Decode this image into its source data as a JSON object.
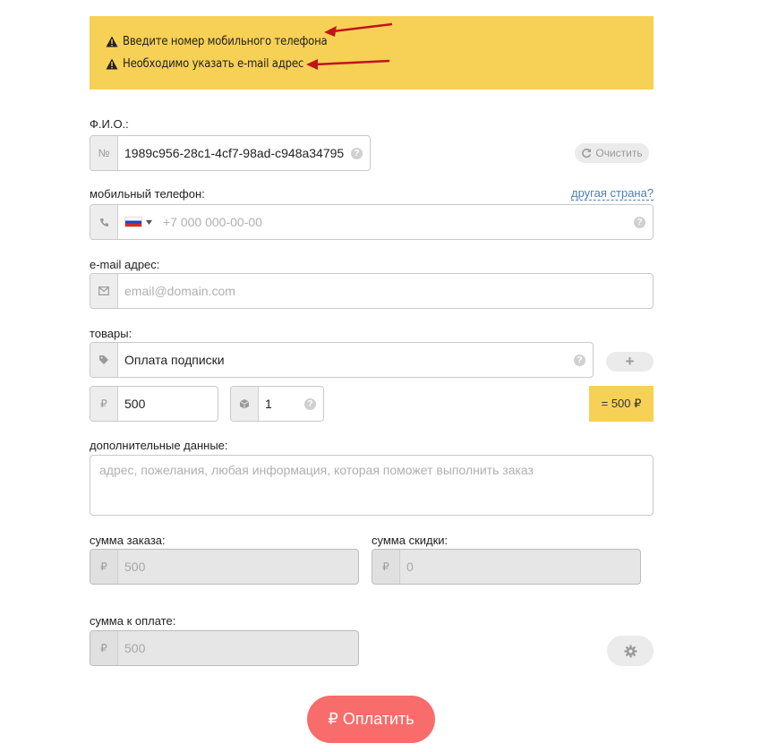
{
  "alert": {
    "messages": [
      "Введите номер мобильного телефона",
      "Необходимо указать e-mail адрес"
    ]
  },
  "name_field": {
    "label": "Ф.И.О.:",
    "addon_icon": "№",
    "value": "1989c956-28c1-4cf7-98ad-c948a34795",
    "help": "?"
  },
  "clear_button": {
    "label": "Очистить",
    "icon": "refresh-icon"
  },
  "phone_field": {
    "label": "мобильный телефон:",
    "other_country_link": "другая страна?",
    "placeholder": "+7 000 000-00-00",
    "country_flag": "russia-flag",
    "help": "?"
  },
  "email_field": {
    "label": "e-mail адрес:",
    "placeholder": "email@domain.com"
  },
  "goods": {
    "label": "товары:",
    "item_value": "Оплата подписки",
    "help": "?",
    "add_button_label": "+",
    "price_currency": "₽",
    "price_value": "500",
    "quantity_value": "1",
    "total_label": "= 500 ₽"
  },
  "extra": {
    "label": "дополнительные данные:",
    "placeholder": "адрес, пожелания, любая информация, которая поможет выполнить заказ"
  },
  "order_sum": {
    "label": "сумма заказа:",
    "currency": "₽",
    "value": "500"
  },
  "discount_sum": {
    "label": "сумма скидки:",
    "currency": "₽",
    "value": "0"
  },
  "payable_sum": {
    "label": "сумма к оплате:",
    "currency": "₽",
    "value": "500"
  },
  "pay_button": {
    "label": "₽ Оплатить"
  },
  "colors": {
    "alert_bg": "#f7d155",
    "pay_button": "#f86c6b",
    "link": "#4a7fb5",
    "arrow": "#c0141a"
  }
}
